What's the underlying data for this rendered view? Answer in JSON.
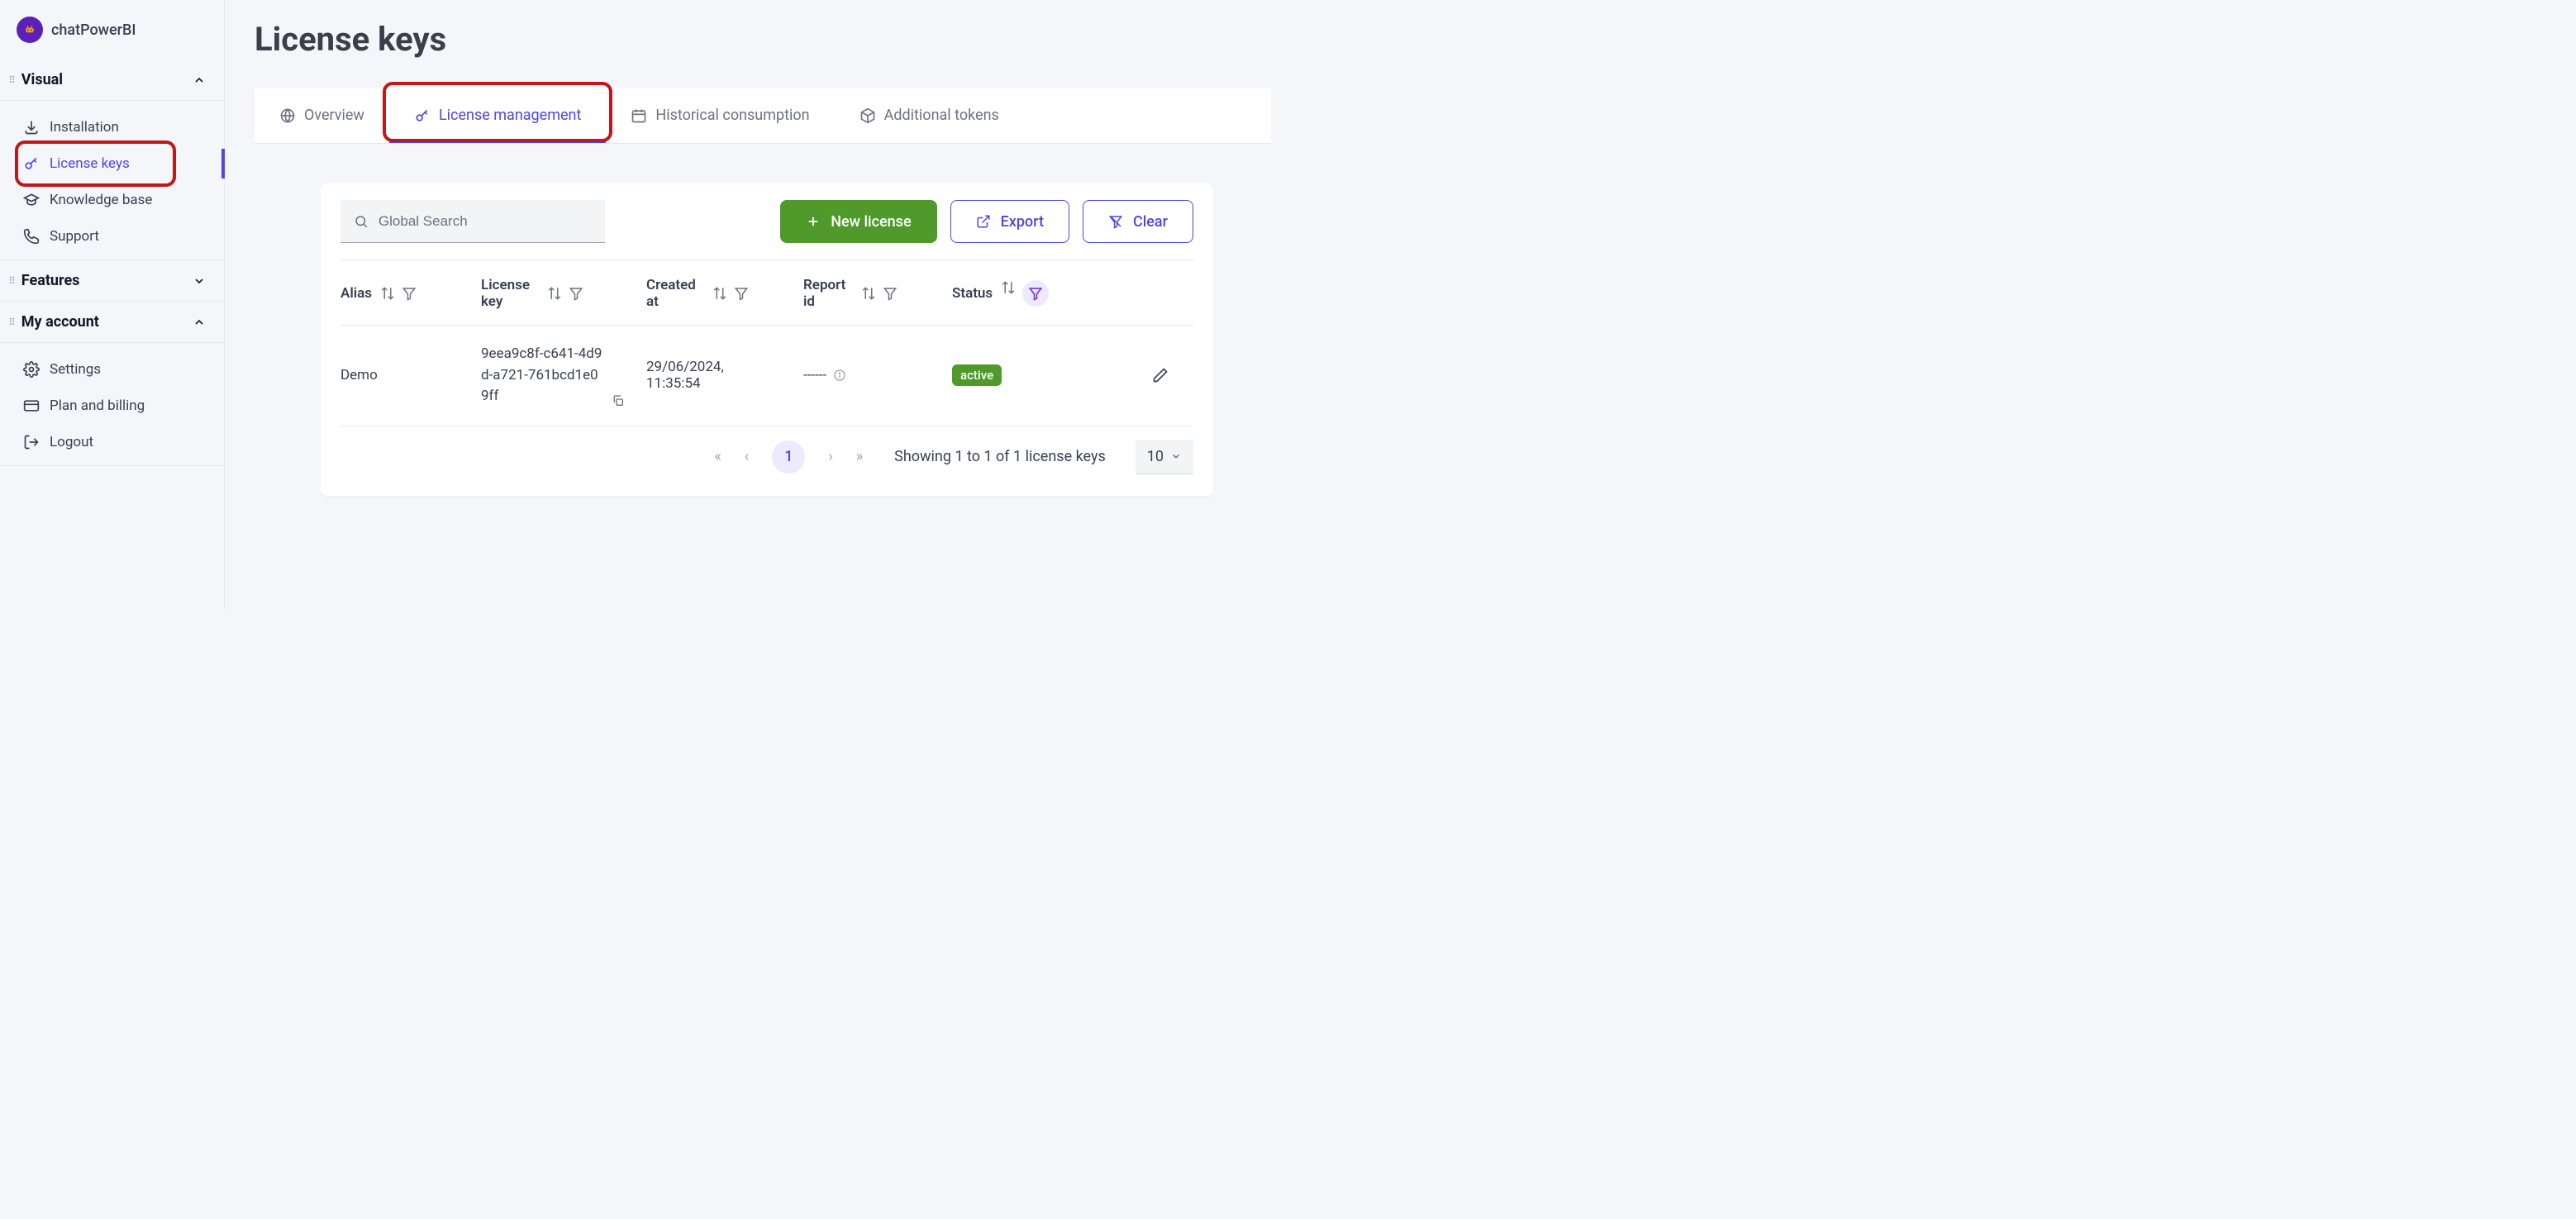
{
  "brand": {
    "name": "chatPowerBI"
  },
  "sidebar": {
    "sections": [
      {
        "title": "Visual",
        "open": true,
        "items": [
          {
            "label": "Installation"
          },
          {
            "label": "License keys",
            "active": true
          },
          {
            "label": "Knowledge base"
          },
          {
            "label": "Support"
          }
        ]
      },
      {
        "title": "Features",
        "open": false,
        "items": []
      },
      {
        "title": "My account",
        "open": true,
        "items": [
          {
            "label": "Settings"
          },
          {
            "label": "Plan and billing"
          },
          {
            "label": "Logout"
          }
        ]
      }
    ]
  },
  "page": {
    "title": "License keys"
  },
  "tabs": [
    {
      "label": "Overview"
    },
    {
      "label": "License management",
      "active": true
    },
    {
      "label": "Historical consumption"
    },
    {
      "label": "Additional tokens"
    }
  ],
  "toolbar": {
    "search_placeholder": "Global Search",
    "new_label": "New license",
    "export_label": "Export",
    "clear_label": "Clear"
  },
  "table": {
    "columns": [
      {
        "label": "Alias"
      },
      {
        "label": "License key"
      },
      {
        "label": "Created at"
      },
      {
        "label": "Report id"
      },
      {
        "label": "Status"
      }
    ],
    "rows": [
      {
        "alias": "Demo",
        "license_key": "9eea9c8f-c641-4d9d-a721-761bcd1e09ff",
        "created_at": "29/06/2024, 11:35:54",
        "report_id": "------",
        "status": "active"
      }
    ]
  },
  "pagination": {
    "current_page": "1",
    "info": "Showing 1 to 1 of 1 license keys",
    "page_size": "10"
  }
}
